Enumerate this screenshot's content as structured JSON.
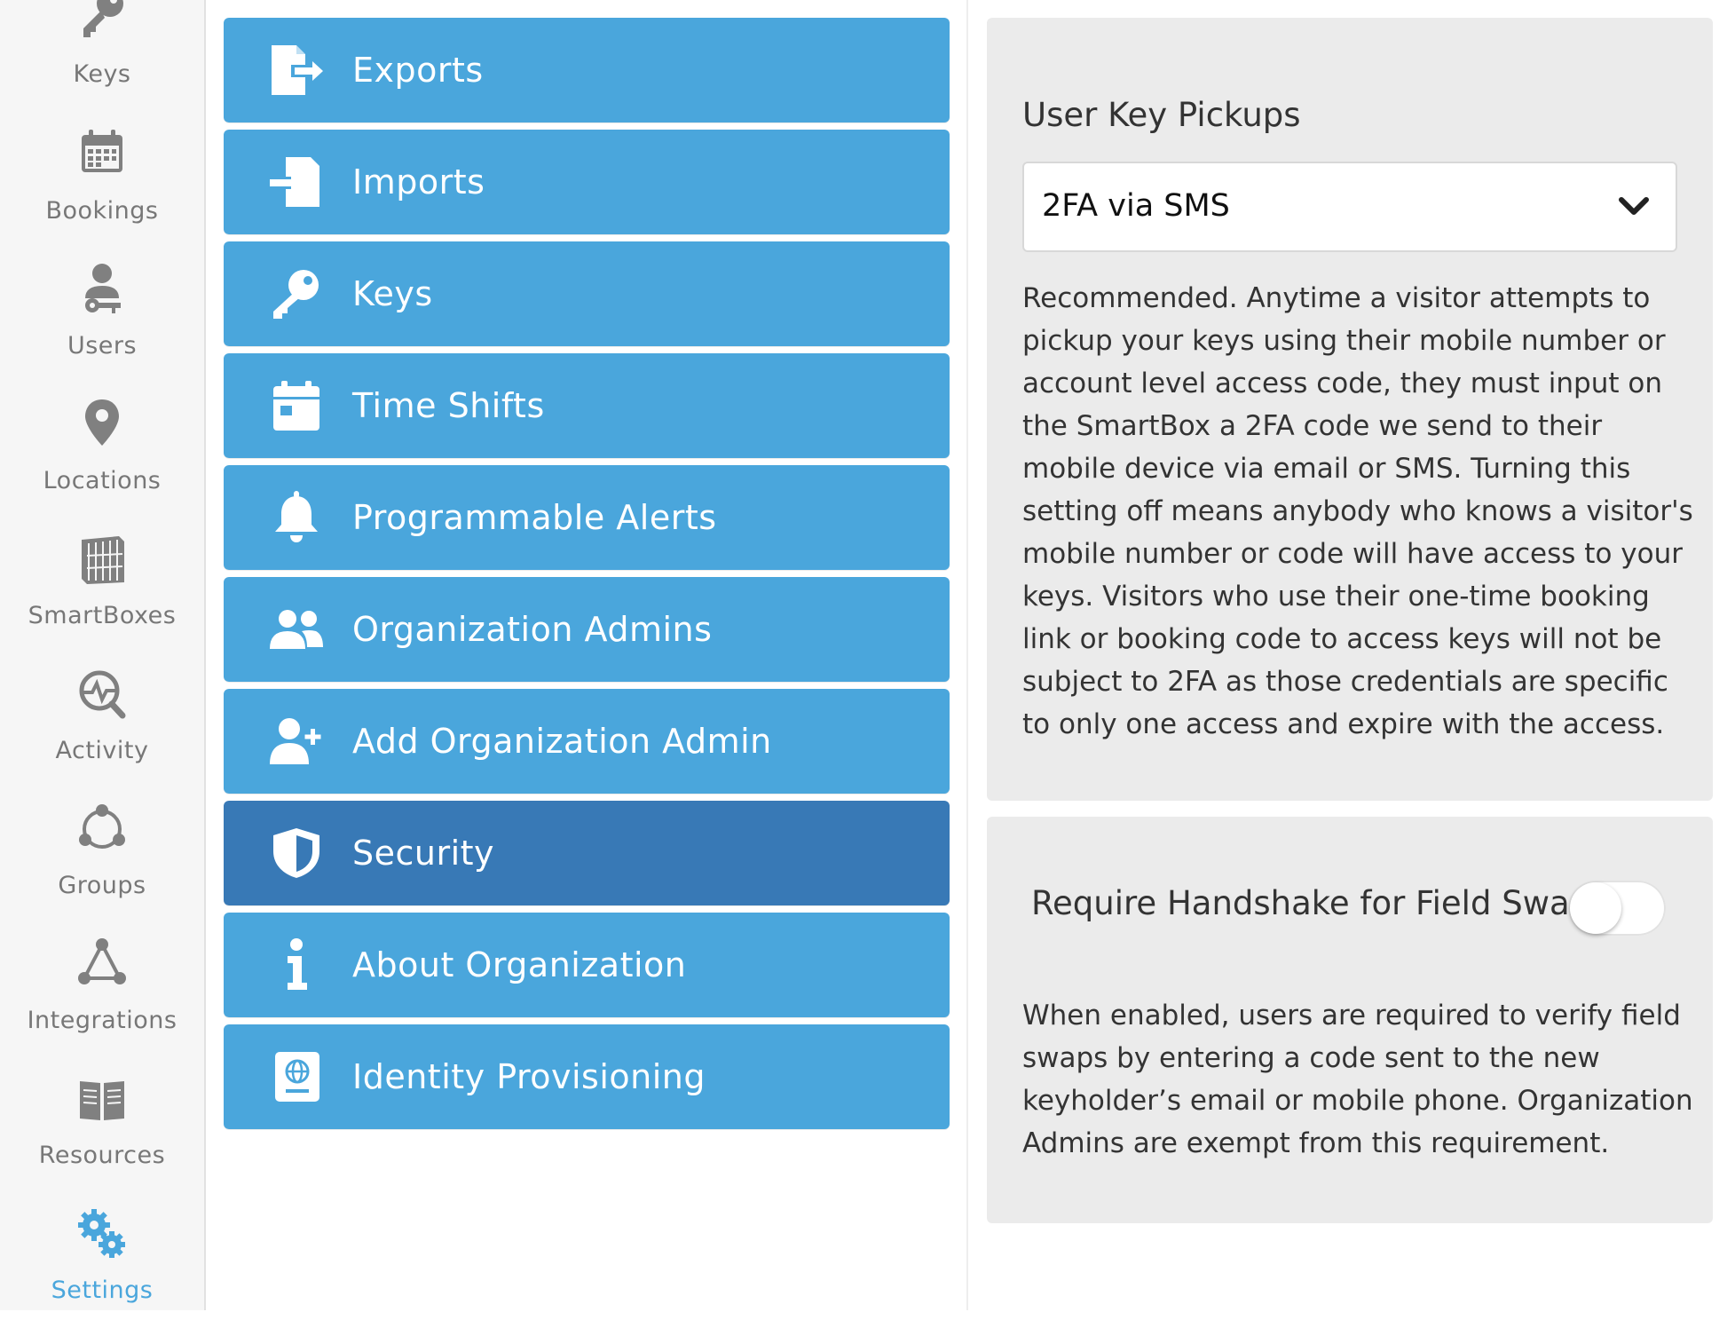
{
  "colors": {
    "accent": "#4aa6dc",
    "accent_active": "#3879b6",
    "nav_icon": "#777777",
    "panel_bg": "#ebebeb"
  },
  "nav": {
    "items": [
      {
        "label": "Keys",
        "icon": "key-icon",
        "active": false
      },
      {
        "label": "Bookings",
        "icon": "calendar-icon",
        "active": false
      },
      {
        "label": "Users",
        "icon": "user-key-icon",
        "active": false
      },
      {
        "label": "Locations",
        "icon": "map-pin-icon",
        "active": false
      },
      {
        "label": "SmartBoxes",
        "icon": "smartbox-icon",
        "active": false
      },
      {
        "label": "Activity",
        "icon": "activity-icon",
        "active": false
      },
      {
        "label": "Groups",
        "icon": "groups-icon",
        "active": false
      },
      {
        "label": "Integrations",
        "icon": "integrations-icon",
        "active": false
      },
      {
        "label": "Resources",
        "icon": "book-icon",
        "active": false
      },
      {
        "label": "Settings",
        "icon": "gears-icon",
        "active": true
      }
    ]
  },
  "menu": {
    "items": [
      {
        "label": "Exports",
        "icon": "export-icon",
        "active": false
      },
      {
        "label": "Imports",
        "icon": "import-icon",
        "active": false
      },
      {
        "label": "Keys",
        "icon": "key-icon",
        "active": false
      },
      {
        "label": "Time Shifts",
        "icon": "calendar-icon",
        "active": false
      },
      {
        "label": "Programmable Alerts",
        "icon": "bell-icon",
        "active": false
      },
      {
        "label": "Organization Admins",
        "icon": "users-icon",
        "active": false
      },
      {
        "label": "Add Organization Admin",
        "icon": "user-plus-icon",
        "active": false
      },
      {
        "label": "Security",
        "icon": "shield-icon",
        "active": true
      },
      {
        "label": "About Organization",
        "icon": "info-icon",
        "active": false
      },
      {
        "label": "Identity Provisioning",
        "icon": "passport-icon",
        "active": false
      }
    ]
  },
  "user_key_pickups": {
    "title": "User Key Pickups",
    "selected": "2FA via SMS",
    "description": "Recommended. Anytime a visitor attempts to pickup your keys using their mobile number or account level access code, they must input on the SmartBox a 2FA code we send to their mobile device via email or SMS. Turning this setting off means anybody who knows a visitor's mobile number or code will have access to your keys. Visitors who use their one-time booking link or booking code to access keys will not be subject to 2FA as those credentials are specific to only one access and expire with the access."
  },
  "handshake": {
    "label": "Require Handshake for Field Swap",
    "enabled": false,
    "description": "When enabled, users are required to verify field swaps by entering a code sent to the new keyholder’s email or mobile phone. Organization Admins are exempt from this requirement."
  }
}
